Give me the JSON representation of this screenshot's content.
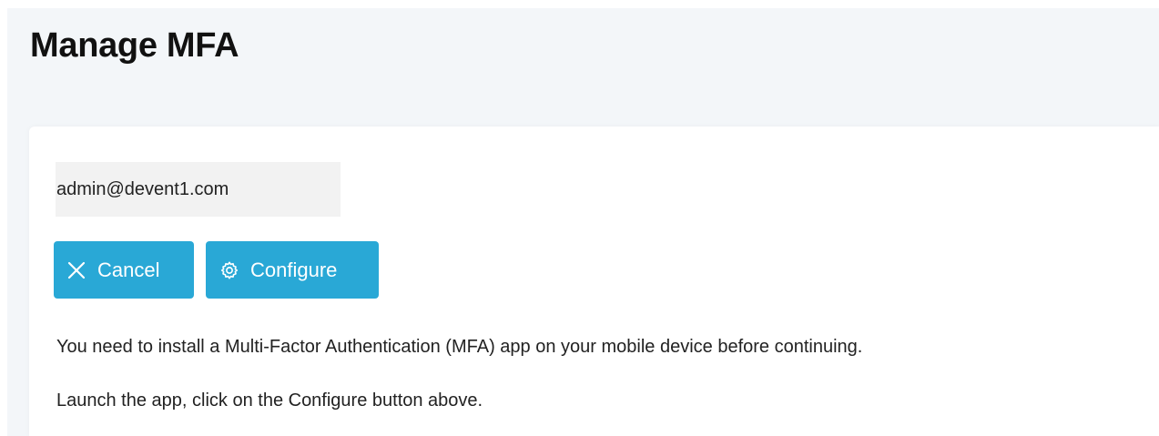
{
  "page": {
    "title": "Manage MFA"
  },
  "account": {
    "email": "admin@devent1.com"
  },
  "actions": {
    "cancel_label": "Cancel",
    "configure_label": "Configure"
  },
  "instructions": {
    "line1": "You need to install a Multi-Factor Authentication (MFA) app on your mobile device before continuing.",
    "line2": "Launch the app, click on the Configure button above."
  },
  "icons": {
    "cancel": "close-icon",
    "configure": "gear-icon"
  },
  "colors": {
    "button_bg": "#29a8d6",
    "page_bg": "#f3f6f9"
  }
}
